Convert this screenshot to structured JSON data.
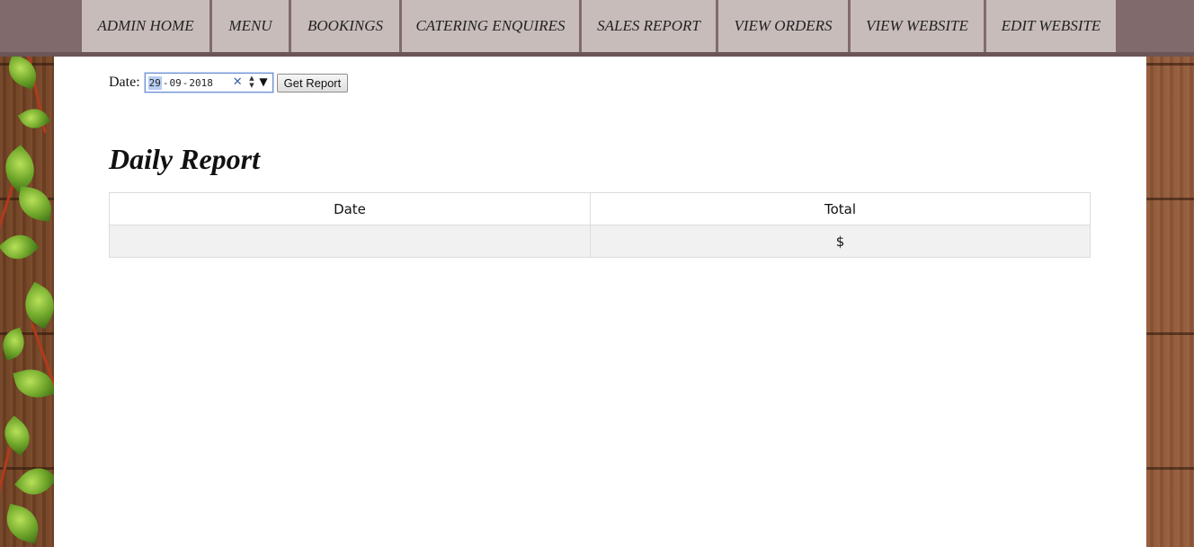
{
  "nav": {
    "items": [
      {
        "label": "ADMIN HOME"
      },
      {
        "label": "MENU"
      },
      {
        "label": "BOOKINGS"
      },
      {
        "label": "CATERING ENQUIRES"
      },
      {
        "label": "SALES REPORT"
      },
      {
        "label": "VIEW ORDERS"
      },
      {
        "label": "VIEW WEBSITE"
      },
      {
        "label": "EDIT WEBSITE"
      }
    ]
  },
  "filter": {
    "date_label": "Date:",
    "date_day": "29",
    "date_month": "09",
    "date_year": "2018",
    "separator": "-",
    "clear_glyph": "✕",
    "spin_up": "▲",
    "spin_down": "▼",
    "dropdown_glyph": "▼",
    "button_label": "Get Report"
  },
  "report": {
    "title": "Daily Report",
    "columns": [
      "Date",
      "Total"
    ],
    "rows": [
      {
        "date": "",
        "total": "$"
      }
    ]
  },
  "icons": {
    "clear": "close-icon",
    "spin": "spinner-icon",
    "dropdown": "chevron-down-icon"
  },
  "colors": {
    "nav_bg": "#806a6c",
    "nav_item_bg": "#c8bcbb",
    "date_focus": "#6d8fd0",
    "row_bg": "#f1f1f1"
  }
}
